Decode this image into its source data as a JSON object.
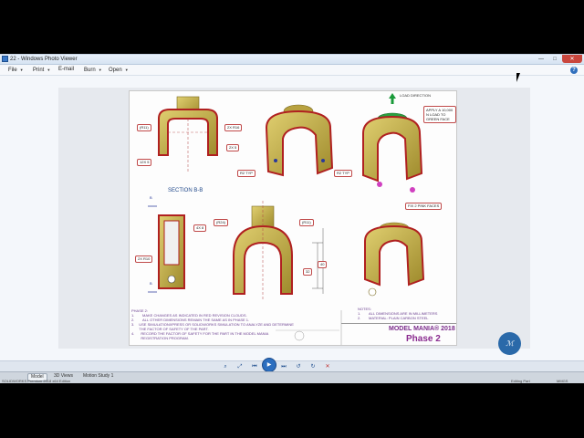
{
  "window": {
    "title": "22 - Windows Photo Viewer",
    "buttons": {
      "minimize": "—",
      "maximize": "□",
      "close": "✕"
    }
  },
  "menu": {
    "items": [
      {
        "label": "File"
      },
      {
        "label": "Print"
      },
      {
        "label": "E-mail"
      },
      {
        "label": "Burn"
      },
      {
        "label": "Open"
      }
    ],
    "help": "?"
  },
  "drawing": {
    "callouts": {
      "r11": "(R11)",
      "r16": "2X R16",
      "d5": "2X 5",
      "x5": "12X 5",
      "r2typ_left": "R2 TYP",
      "r2typ_right": "R2 TYP",
      "r24": "(R24)",
      "r11_b": "(R11)",
      "r10": "2X R10",
      "dim8": "4X 8",
      "dim32": "32",
      "dim40": "40",
      "load_direction": "LOAD DIRECTION",
      "apply_load": "APPLY A 10,000 N LOAD TO GREEN FACE",
      "fix_pink": "FIX 2 PINK FACES",
      "section": "SECTION B-B",
      "b_top": "B",
      "b_bottom": "B"
    },
    "phase_notes": {
      "heading": "PHASE 2:",
      "items": [
        {
          "num": "1.",
          "text": "MAKE CHANGES AS INDICATED IN RED REVISION CLOUDS."
        },
        {
          "num": "2.",
          "text": "ALL OTHER DIMENSIONS REMAIN THE SAME AS IN PHASE 1."
        },
        {
          "num": "3.",
          "text": "USE SIMULATIONXPRESS OR SOLIDWORKS SIMULATION TO ANALYZE AND DETERMINE THE FACTOR OF SAFETY OF THE PART."
        },
        {
          "num": "4.",
          "text": "RECORD THE FACTOR OF SAFETY FOR THE PART IN THE MODEL MANIA REGISTRATION PROGRAM."
        }
      ]
    },
    "notes": {
      "heading": "NOTES:",
      "items": [
        {
          "num": "1.",
          "text": "ALL DIMENSIONS ARE IN MILLIMETERS"
        },
        {
          "num": "2.",
          "text": "MATERIAL: PLAIN CARBON STEEL"
        }
      ]
    },
    "title_block": {
      "title": "MODEL MANIA® 2018",
      "phase": "Phase 2"
    }
  },
  "cad_app": {
    "tabs": [
      {
        "label": "Model"
      },
      {
        "label": "3D Views"
      },
      {
        "label": "Motion Study 1"
      }
    ],
    "status_left": "SOLIDWORKS Premium 2018 x64 Edition",
    "status_right": "Editing Part",
    "units": "MMGS"
  },
  "colors": {
    "part_gold": "#c8b24a",
    "part_red": "#b02020",
    "accent_blue": "#2b6ebf"
  }
}
